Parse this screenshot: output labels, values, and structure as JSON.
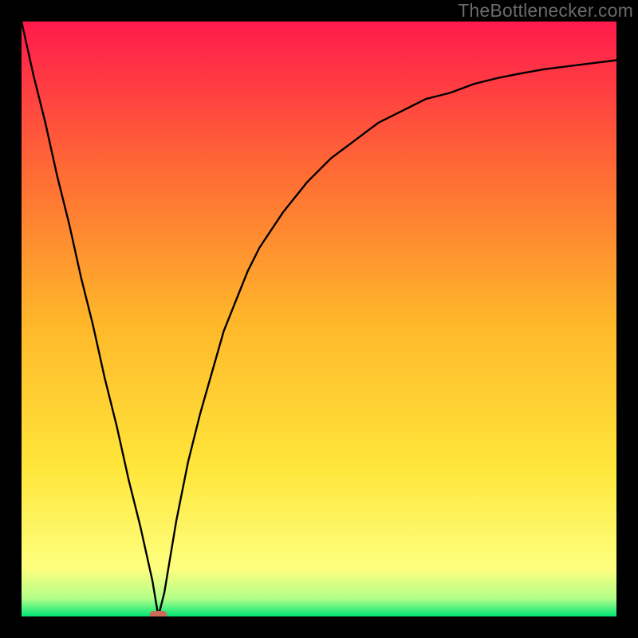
{
  "watermark": "TheBottlenecker.com",
  "colors": {
    "gradient_top": "#ff1a4c",
    "gradient_q1": "#ff6a35",
    "gradient_mid": "#ffb62a",
    "gradient_q3": "#ffe63a",
    "gradient_low": "#feff7f",
    "gradient_base1": "#b1ff88",
    "gradient_bottom": "#00e676",
    "frame": "#000000",
    "curve": "#000000",
    "marker": "#cc6b5a"
  },
  "chart_data": {
    "type": "line",
    "title": "",
    "xlabel": "",
    "ylabel": "",
    "xlim": [
      0,
      100
    ],
    "ylim": [
      0,
      100
    ],
    "grid": false,
    "legend": false,
    "series": [
      {
        "name": "bottleneck-curve",
        "x": [
          0,
          2,
          4,
          6,
          8,
          10,
          12,
          14,
          16,
          18,
          20,
          22,
          23,
          24,
          26,
          28,
          30,
          32,
          34,
          36,
          38,
          40,
          44,
          48,
          52,
          56,
          60,
          64,
          68,
          72,
          76,
          80,
          84,
          88,
          92,
          96,
          100
        ],
        "y": [
          100,
          91,
          83,
          74,
          66,
          57,
          49,
          40,
          32,
          23,
          15,
          6,
          0,
          4,
          16,
          26,
          34,
          41,
          48,
          53,
          58,
          62,
          68,
          73,
          77,
          80,
          83,
          85,
          87,
          88,
          89.5,
          90.5,
          91.3,
          92,
          92.5,
          93,
          93.5
        ]
      }
    ],
    "annotations": [
      {
        "type": "marker",
        "shape": "pill",
        "x": 23,
        "y": 0,
        "color": "#cc6b5a"
      }
    ]
  }
}
